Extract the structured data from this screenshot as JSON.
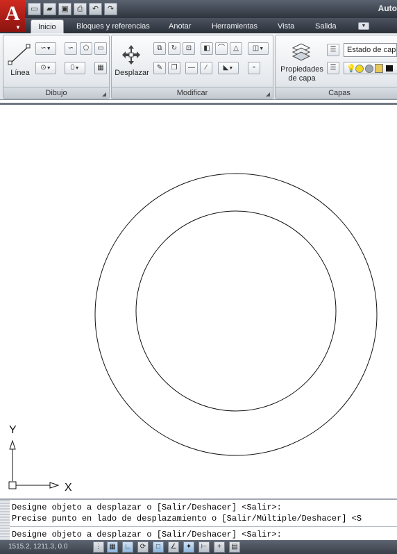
{
  "app": {
    "title": "Auto"
  },
  "quick_access": [
    {
      "name": "new-icon",
      "glyph": "▭"
    },
    {
      "name": "open-icon",
      "glyph": "▰"
    },
    {
      "name": "save-icon",
      "glyph": "▣"
    },
    {
      "name": "print-icon",
      "glyph": "⎙"
    },
    {
      "name": "undo-icon",
      "glyph": "↶"
    },
    {
      "name": "redo-icon",
      "glyph": "↷"
    }
  ],
  "tabs": {
    "inicio": "Inicio",
    "bloques": "Bloques y referencias",
    "anotar": "Anotar",
    "herramientas": "Herramientas",
    "vista": "Vista",
    "salida": "Salida"
  },
  "ribbon": {
    "draw": {
      "title": "Dibujo",
      "line_label": "Línea"
    },
    "modify": {
      "title": "Modificar",
      "move_label": "Desplazar"
    },
    "layers": {
      "title": "Capas",
      "props_label_1": "Propiedades",
      "props_label_2": "de capa",
      "state_combo": "Estado de capa"
    }
  },
  "drawing": {
    "ucs": {
      "y_label": "Y",
      "x_label": "X"
    }
  },
  "command": {
    "line1": "Designe objeto a desplazar o [Salir/Deshacer] <Salir>:",
    "line2": "Precise punto en lado de desplazamiento o [Salir/Múltiple/Deshacer] <S",
    "prompt": "Designe objeto a desplazar o [Salir/Deshacer] <Salir>:"
  },
  "status": {
    "coordinates": "1515.2, 1211.3, 0.0"
  },
  "colors": {
    "accent": "#c8231a",
    "ribbon_bg": "#e6e9ed",
    "titlebar": "#3a414b"
  }
}
